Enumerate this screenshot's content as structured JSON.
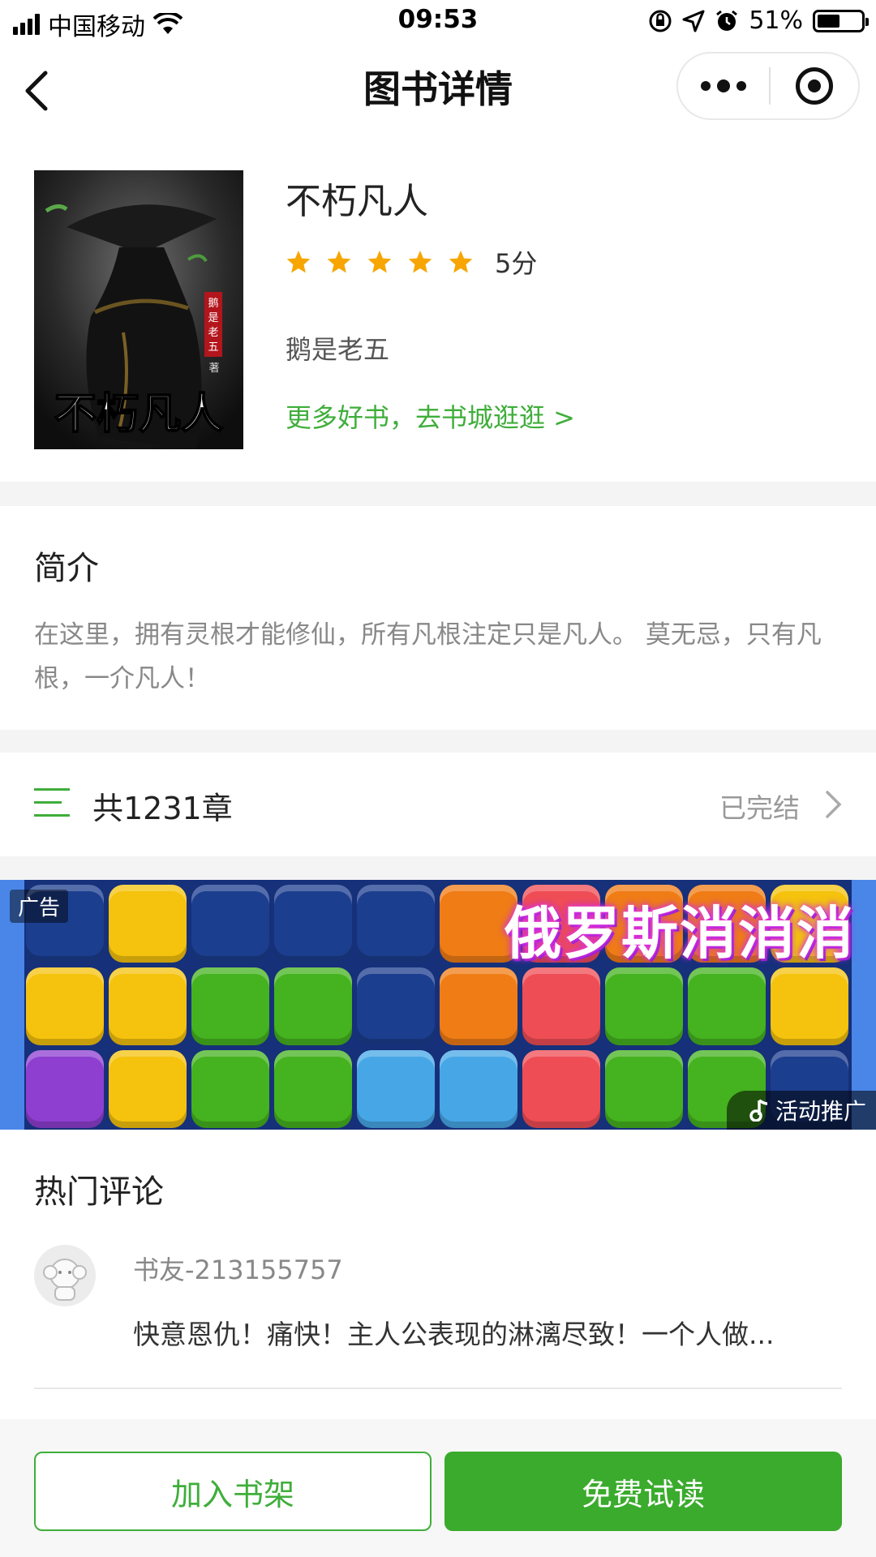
{
  "status_bar": {
    "carrier": "中国移动",
    "time": "09:53",
    "battery_percent": "51%",
    "battery_level": 0.51
  },
  "nav": {
    "title": "图书详情"
  },
  "book": {
    "title": "不朽凡人",
    "rating_stars": 5,
    "score": "5分",
    "author": "鹅是老五",
    "more_link": "更多好书，去书城逛逛 >",
    "cover_title": "不朽凡人",
    "cover_author_seal": "鹅是老五",
    "cover_author_suffix": "著"
  },
  "intro": {
    "heading": "简介",
    "text": " 在这里，拥有灵根才能修仙，所有凡根注定只是凡人。  莫无忌，只有凡根，一介凡人！"
  },
  "chapters": {
    "count_label": "共1231章",
    "status": "已完结"
  },
  "ad": {
    "label": "广告",
    "title": "俄罗斯消消消",
    "promo": "活动推广"
  },
  "comments": {
    "heading": "热门评论",
    "items": [
      {
        "user": "书友-213155757",
        "text": "快意恩仇！痛快！主人公表现的淋漓尽致！一个人做..."
      }
    ]
  },
  "actions": {
    "add_shelf": "加入书架",
    "free_read": "免费试读"
  },
  "colors": {
    "accent_green": "#3fae3a",
    "star_orange": "#f7a500",
    "ad_background": "#16307a"
  },
  "icons": [
    "back-arrow-icon",
    "more-dots-icon",
    "close-target-icon",
    "star-icon",
    "list-icon",
    "chevron-right-icon",
    "wifi-icon",
    "lock-rotation-icon",
    "location-icon",
    "alarm-icon",
    "battery-icon",
    "music-note-icon"
  ]
}
